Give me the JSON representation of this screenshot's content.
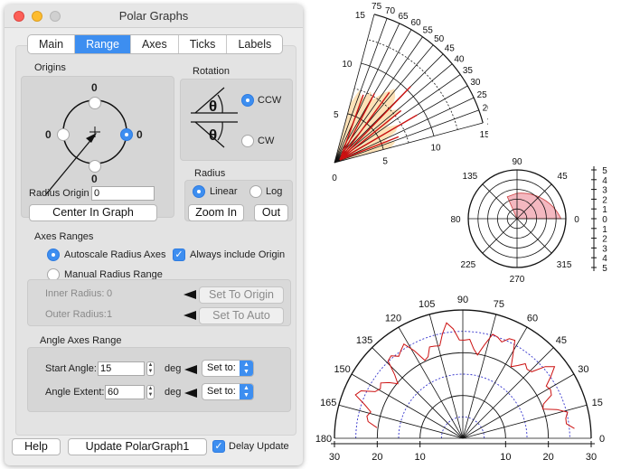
{
  "window": {
    "title": "Polar Graphs"
  },
  "tabs": [
    {
      "label": "Main",
      "active": false
    },
    {
      "label": "Range",
      "active": true
    },
    {
      "label": "Axes",
      "active": false
    },
    {
      "label": "Ticks",
      "active": false
    },
    {
      "label": "Labels",
      "active": false
    }
  ],
  "origins": {
    "title": "Origins",
    "zero_top": "0",
    "zero_left": "0",
    "zero_right": "0",
    "zero_bottom": "0",
    "radius_origin_label": "Radius Origin",
    "radius_origin_value": "0",
    "center_button": "Center In Graph"
  },
  "rotation": {
    "title": "Rotation",
    "ccw": "CCW",
    "cw": "CW",
    "selected": "CCW",
    "theta": "θ"
  },
  "radius": {
    "title": "Radius",
    "linear": "Linear",
    "log": "Log",
    "selected": "Linear",
    "zoom_in": "Zoom In",
    "out": "Out"
  },
  "axes_ranges": {
    "title": "Axes Ranges",
    "autoscale": "Autoscale Radius Axes",
    "always_include_origin": "Always include Origin",
    "manual": "Manual Radius Range",
    "inner_label": "Inner Radius:",
    "inner_value": "0",
    "outer_label": "Outer Radius:",
    "outer_value": "1",
    "set_to_origin": "Set To Origin",
    "set_to_auto": "Set To Auto"
  },
  "angle_range": {
    "title": "Angle Axes Range",
    "start_label": "Start Angle:",
    "start_value": "15",
    "extent_label": "Angle Extent:",
    "extent_value": "60",
    "deg": "deg",
    "set_to": "Set to:"
  },
  "footer": {
    "help": "Help",
    "update": "Update PolarGraph1",
    "delay_update": "Delay Update"
  },
  "graphs": {
    "g1": {
      "angle_ticks": [
        "75",
        "70",
        "65",
        "60",
        "55",
        "50",
        "45",
        "40",
        "35",
        "30",
        "25",
        "20",
        "15"
      ],
      "radius_ticks_upper": [
        "15",
        "10",
        "5"
      ],
      "radius_ticks_lower": [
        "5",
        "10",
        "15"
      ],
      "origin_label": "0"
    },
    "g2": {
      "angle_ticks": [
        "90",
        "45",
        "0",
        "315",
        "270",
        "225",
        "80",
        "135"
      ],
      "radius_scale": [
        "5",
        "4",
        "3",
        "2",
        "1",
        "0",
        "1",
        "2",
        "3",
        "4",
        "5"
      ]
    },
    "g3": {
      "angle_ticks": [
        "90",
        "75",
        "60",
        "45",
        "30",
        "15",
        "0",
        "105",
        "120",
        "135",
        "150",
        "165",
        "180"
      ],
      "radius_ticks": [
        "30",
        "20",
        "10",
        "10",
        "20",
        "30"
      ]
    }
  },
  "colors": {
    "accent": "#3d8ef0",
    "plot_red": "#cc1111",
    "fill_orange": "#fde2b8",
    "fill_pink": "#f4b8c0",
    "grid_blue": "#3333cc"
  }
}
